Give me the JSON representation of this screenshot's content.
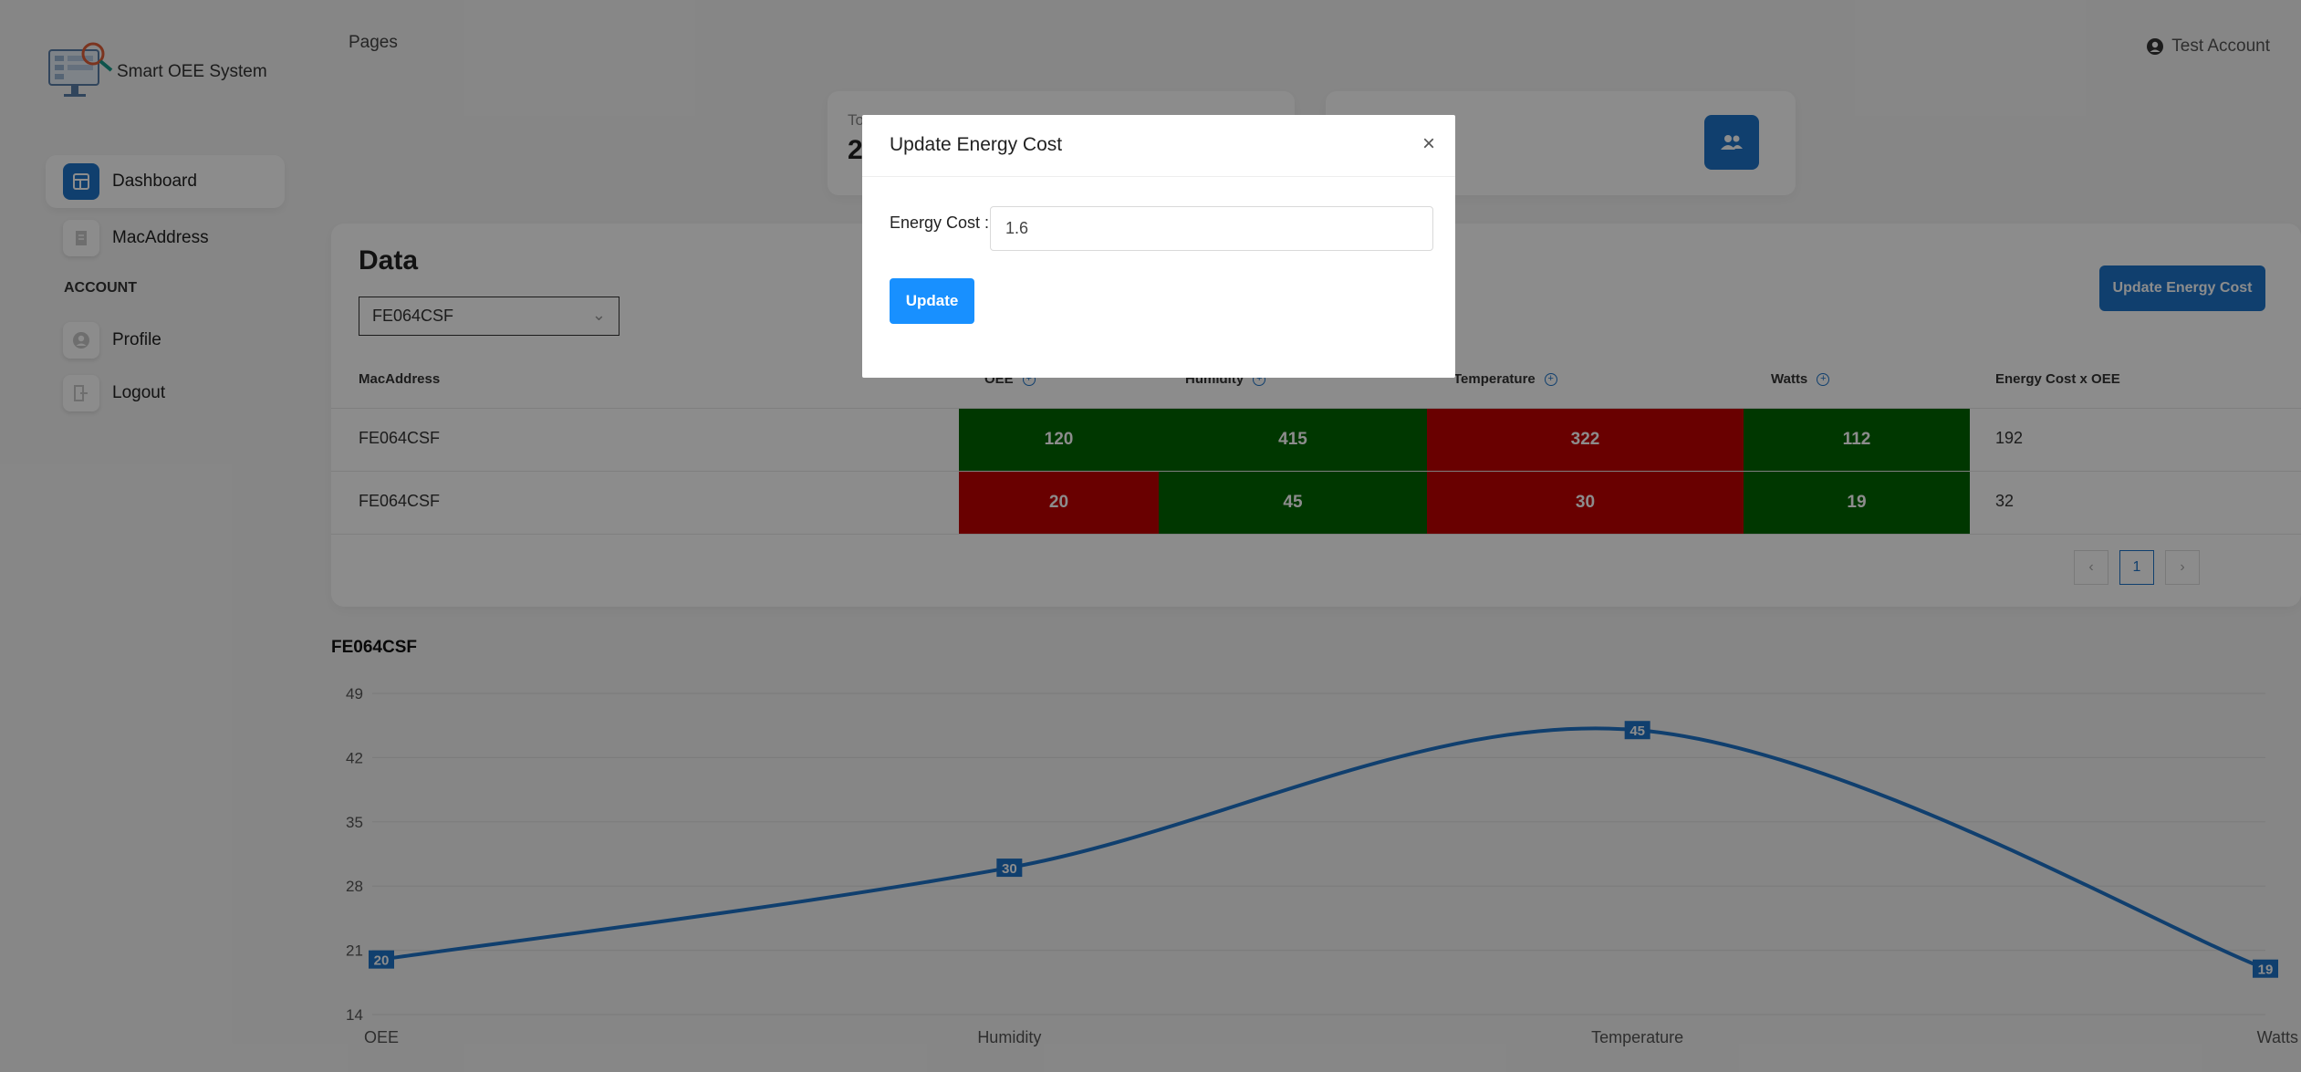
{
  "app": {
    "brand": "Smart OEE System"
  },
  "header": {
    "breadcrumb": "Pages",
    "account_name": "Test Account"
  },
  "sidebar": {
    "items": [
      {
        "label": "Dashboard",
        "icon": "dashboard-icon",
        "active": true
      },
      {
        "label": "MacAddress",
        "icon": "document-icon",
        "active": false
      }
    ],
    "section": "ACCOUNT",
    "account_items": [
      {
        "label": "Profile",
        "icon": "user-icon"
      },
      {
        "label": "Logout",
        "icon": "logout-icon"
      }
    ]
  },
  "stats": {
    "card1_title": "To",
    "card1_value": "2"
  },
  "data_section": {
    "title": "Data",
    "selected_mac": "FE064CSF",
    "update_button": "Update Energy Cost",
    "columns": [
      "MacAddress",
      "OEE",
      "Humidity",
      "Temperature",
      "Watts",
      "Energy Cost x OEE"
    ],
    "rows": [
      {
        "mac": "FE064CSF",
        "oee": "120",
        "humidity": "415",
        "temperature": "322",
        "watts": "112",
        "cost": "192"
      },
      {
        "mac": "FE064CSF",
        "oee": "20",
        "humidity": "45",
        "temperature": "30",
        "watts": "19",
        "cost": "32"
      }
    ],
    "cell_status": [
      [
        "green",
        "green",
        "red",
        "green"
      ],
      [
        "red",
        "green",
        "red",
        "green"
      ]
    ],
    "page": "1"
  },
  "colors": {
    "accent": "#1e73c8",
    "good": "#006400",
    "bad": "#c00000",
    "line": "#1e73c8"
  },
  "modal": {
    "title": "Update Energy Cost",
    "close": "×",
    "field_label": "Energy Cost :",
    "field_value": "1.6",
    "submit": "Update"
  },
  "chart_data": {
    "type": "line",
    "title": "FE064CSF",
    "categories": [
      "OEE",
      "Humidity",
      "Temperature",
      "Watts"
    ],
    "values": [
      20,
      30,
      45,
      19
    ],
    "yticks": [
      49,
      42,
      35,
      28,
      21,
      14
    ],
    "ylim": [
      14,
      49
    ],
    "grid": true,
    "data_labels": true
  }
}
